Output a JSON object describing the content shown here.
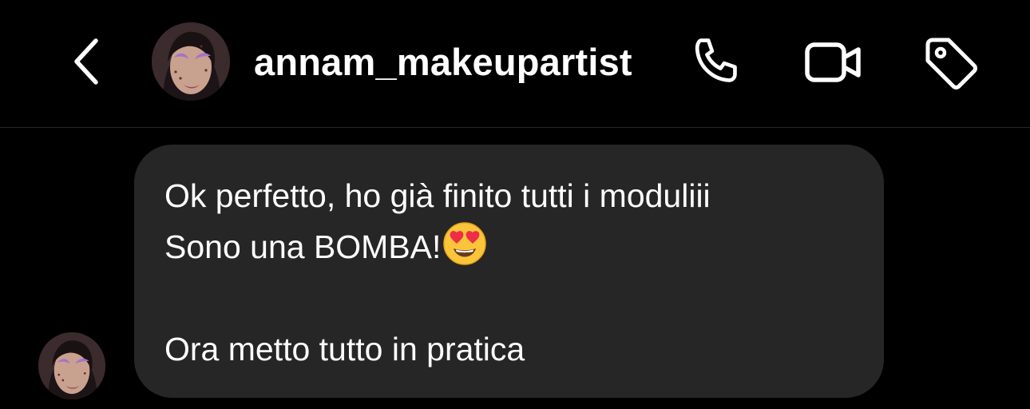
{
  "header": {
    "username": "annam_makeupartist",
    "back_icon": "chevron-left-icon",
    "call_icon": "phone-icon",
    "video_icon": "video-camera-icon",
    "tag_icon": "tag-icon"
  },
  "message": {
    "lines": [
      "Ok perfetto, ho già finito tutti i moduliii",
      "Sono una BOMBA!",
      "",
      "Ora metto tutto in pratica"
    ],
    "emoji": "heart-eyes-emoji"
  },
  "colors": {
    "background": "#000000",
    "bubble": "#262626",
    "text": "#ffffff",
    "divider": "#262626"
  }
}
